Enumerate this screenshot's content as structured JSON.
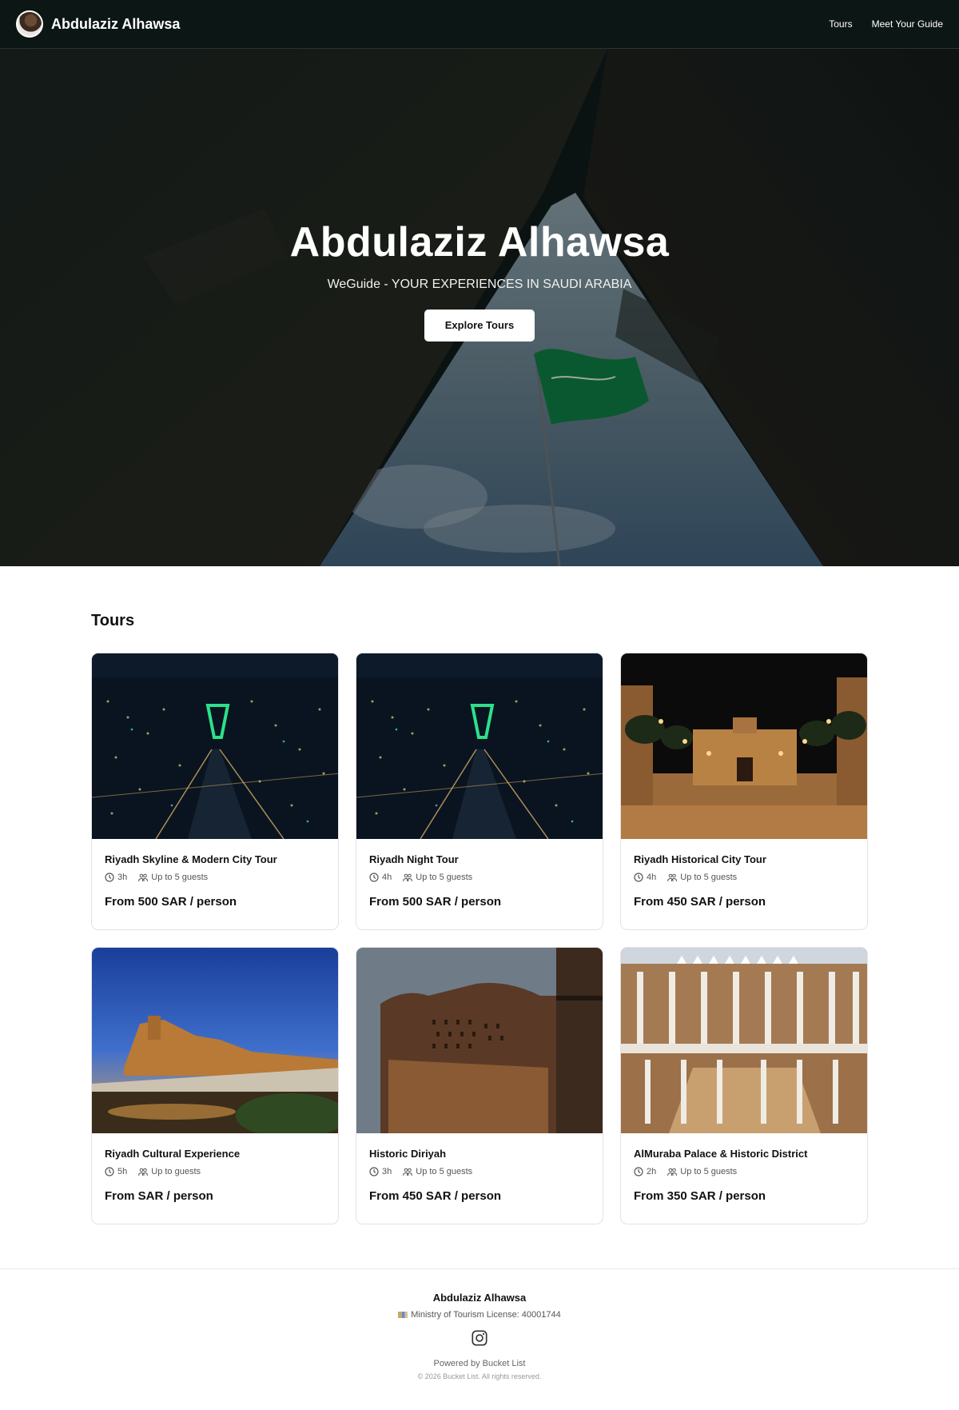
{
  "header": {
    "brand_name": "Abdulaziz Alhawsa",
    "nav": [
      "Tours",
      "Meet Your Guide"
    ]
  },
  "hero": {
    "title": "Abdulaziz Alhawsa",
    "subtitle": "WeGuide - YOUR EXPERIENCES IN SAUDI ARABIA",
    "button": "Explore Tours"
  },
  "tours": {
    "heading": "Tours",
    "items": [
      {
        "title": "Riyadh Skyline & Modern City Tour",
        "duration": "3h",
        "guests": "Up to 5 guests",
        "price": "From 500 SAR / person",
        "image": "city-night-aerial"
      },
      {
        "title": "Riyadh Night Tour",
        "duration": "4h",
        "guests": "Up to 5 guests",
        "price": "From 500 SAR / person",
        "image": "city-night-aerial"
      },
      {
        "title": "Riyadh Historical City Tour",
        "duration": "4h",
        "guests": "Up to 5 guests",
        "price": "From 450 SAR / person",
        "image": "historic-palace-night"
      },
      {
        "title": "Riyadh Cultural Experience",
        "duration": "5h",
        "guests": "Up to guests",
        "price": "From SAR / person",
        "image": "diriyah-dusk"
      },
      {
        "title": "Historic Diriyah",
        "duration": "3h",
        "guests": "Up to 5 guests",
        "price": "From 450 SAR / person",
        "image": "mud-brick-wall"
      },
      {
        "title": "AlMuraba Palace & Historic District",
        "duration": "2h",
        "guests": "Up to 5 guests",
        "price": "From 350 SAR / person",
        "image": "palace-courtyard"
      }
    ]
  },
  "footer": {
    "name": "Abdulaziz Alhawsa",
    "license": "Ministry of Tourism License: 40001744",
    "powered": "Powered by Bucket List",
    "copyright": "© 2026 Bucket List. All rights reserved."
  },
  "icons": {
    "duration": "clock-icon",
    "guests": "group-icon",
    "social": "instagram-icon"
  },
  "colors": {
    "header_bg": "#0c1614",
    "flag_green": "#0f8a4a",
    "text": "#111111"
  }
}
